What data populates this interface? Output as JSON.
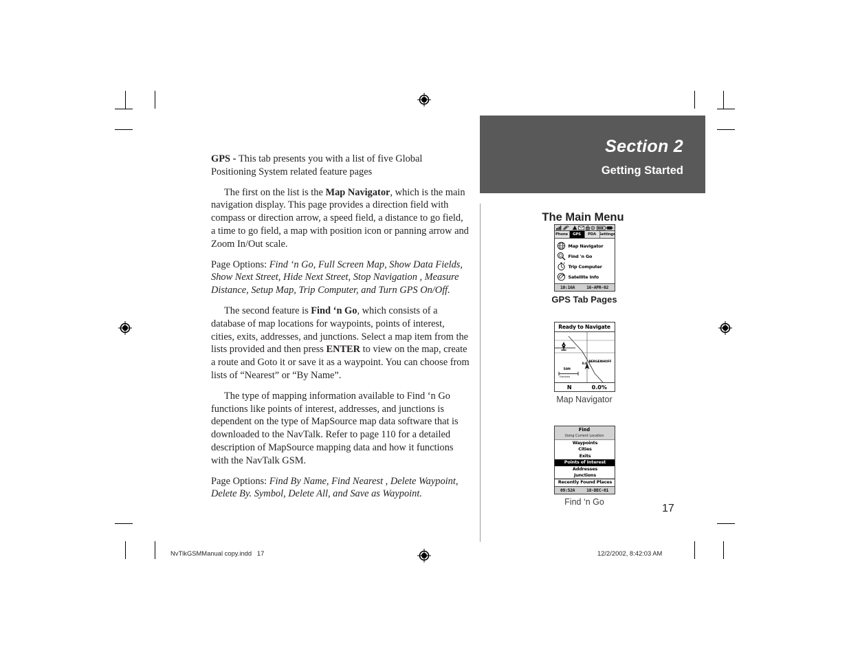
{
  "document": {
    "page_number": "17",
    "footer_left": "NvTlkGSMManual copy.indd   17",
    "footer_right": "12/2/2002, 8:42:03 AM"
  },
  "section": {
    "title": "Section 2",
    "subtitle": "Getting Started",
    "sidebar_heading": "The Main Menu"
  },
  "body": {
    "p1_lead": "GPS - ",
    "p1_rest": "This tab presents you with a list of five Global Positioning System related feature pages",
    "p2_a": "The first on the list is the ",
    "p2_b": "Map Navigator",
    "p2_c": ", which is the main navigation display.  This page provides a direction field with compass or direction arrow, a speed field, a distance to go field, a time to go field, a map with position icon or panning arrow and Zoom In/Out scale.",
    "p3_label": "Page Options: ",
    "p3_options": "Find ‘n Go, Full Screen Map, Show Data Fields, Show Next Street, Hide Next Street, Stop Navigation , Measure Distance, Setup Map, Trip Computer, and Turn GPS On/Off.",
    "p4_a": " The second feature is ",
    "p4_b": "Find ‘n Go",
    "p4_c": ", which consists of a database of map locations for waypoints, points of interest, cities, exits, addresses, and junctions.  Select a map item from the lists provided and then press ",
    "p4_d": "ENTER",
    "p4_e": " to view on the map, create a route and Goto it or save it as a waypoint.  You can choose from lists of “Nearest” or “By Name”.",
    "p5": "The type of mapping information available to Find ‘n Go functions like points of interest, addresses, and junctions is dependent on the type of MapSource map data software that is downloaded to the NavTalk. Refer to page 110 for a detailed description of MapSource mapping data and how it functions with the NavTalk GSM.",
    "p6_label": "Page Options: ",
    "p6_options": "Find By Name, Find Nearest , Delete Waypoint, Delete By. Symbol, Delete All, and Save as Waypoint."
  },
  "figures": [
    {
      "caption": "GPS Tab Pages",
      "caption_bold": true,
      "screen": {
        "type": "main-menu",
        "status_icons": [
          "signal-bars-icon",
          "satellite-icon",
          "triangle-alert-icon",
          "envelope-icon",
          "lock-icon",
          "gear-icon",
          "battery-icon",
          "plug-icon"
        ],
        "tabs": [
          {
            "label": "Phone",
            "active": false
          },
          {
            "label": "GPS",
            "active": true
          },
          {
            "label": "PDA",
            "active": false
          },
          {
            "label": "Settings",
            "active": false
          }
        ],
        "menu_items": [
          {
            "label": "Map Navigator",
            "icon": "globe-map-icon"
          },
          {
            "label": "Find 'n Go",
            "icon": "magnifier-icon"
          },
          {
            "label": "Trip Computer",
            "icon": "stopwatch-icon"
          },
          {
            "label": "Satellite Info",
            "icon": "satellite-dish-icon"
          }
        ],
        "footer_time": "10:16A",
        "footer_date": "16-APR-02"
      }
    },
    {
      "caption": "Map Navigator",
      "caption_bold": false,
      "screen": {
        "type": "map-navigator",
        "title": "Ready to Navigate",
        "map_label": "BERGENHOFF",
        "position_label": "0.0",
        "scale_value": "50ft",
        "scale_sub": "Overview",
        "data_fields": [
          {
            "label": "N"
          },
          {
            "label": "0.0%"
          }
        ]
      }
    },
    {
      "caption": "Find ‘n Go",
      "caption_bold": false,
      "screen": {
        "type": "find",
        "title": "Find",
        "subtitle": "Using Current Location",
        "items": [
          {
            "label": "Waypoints",
            "selected": false
          },
          {
            "label": "Cities",
            "selected": false
          },
          {
            "label": "Exits",
            "selected": false
          },
          {
            "label": "Points of Interest",
            "selected": true
          },
          {
            "label": "Addresses",
            "selected": false
          },
          {
            "label": "Junctions",
            "selected": false
          },
          {
            "label": "Recently Found Places",
            "selected": false
          }
        ],
        "footer_time": "09:52A",
        "footer_date": "18-DEC-01"
      }
    }
  ],
  "colors": {
    "banner": "#595959",
    "text": "#231f20",
    "rule": "#9c9c9c"
  }
}
